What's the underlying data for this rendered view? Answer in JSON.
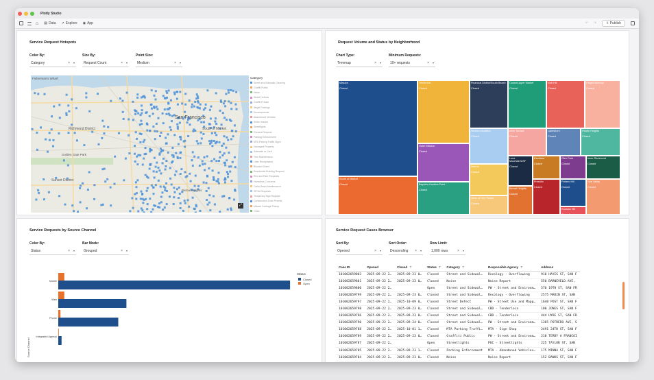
{
  "app": {
    "title": "Plotly Studio",
    "publish_label": "Publish"
  },
  "toolbar": {
    "links": [
      "Data",
      "Explore",
      "App"
    ]
  },
  "panels": {
    "hotspots": {
      "title": "Service Request Hotspots",
      "controls": [
        {
          "label": "Color By:",
          "value": "Category"
        },
        {
          "label": "Size By:",
          "value": "Request Count"
        },
        {
          "label": "Point Size:",
          "value": "Medium"
        }
      ],
      "legend_title": "Category",
      "legend_items": [
        "Street and Sidewalk Cleaning",
        "Graffiti Public",
        "Noise",
        "Street Defects",
        "Graffiti Private",
        "Illegal Postings",
        "Encampments",
        "Abandoned Vehicles",
        "Sewer Issues",
        "Streetlights",
        "General Request",
        "Parking Enforcement",
        "MTA Parking Traffic Signs",
        "Damaged Property",
        "Sidewalk or Curb",
        "Tree Maintenance",
        "Litter Receptacles",
        "Blocked Street",
        "Residential Building Request",
        "Rec and Park Requests",
        "Homeless Concerns",
        "Catch Basin Maintenance",
        "SFHA Requests",
        "Temporary Sign Request",
        "Construction Zone Permits",
        "Missed Garbage Pickup",
        "Other"
      ],
      "map_labels": [
        "Fisherman's Wharf",
        "Richmond District",
        "San Francisco",
        "South of Market",
        "Golden Gate Park",
        "Sunset District",
        "Bernal Heights"
      ],
      "colors": {
        "points": "#4a90d9"
      }
    },
    "volume": {
      "title": "Request Volume and Status by Neighborhood",
      "controls": [
        {
          "label": "Chart Type:",
          "value": "Treemap"
        },
        {
          "label": "Minimum Requests:",
          "value": "10+ requests"
        }
      ],
      "tiles": [
        {
          "label": "Mission",
          "status": "Closed",
          "color": "#1f4e8c"
        },
        {
          "label": "Tenderloin",
          "status": "Closed",
          "color": "#f0b43a"
        },
        {
          "label": "Financial District/South Beach",
          "status": "Closed",
          "color": "#2c3e5a"
        },
        {
          "label": "Castro/Upper Market",
          "status": "Closed",
          "color": "#1f9c78"
        },
        {
          "label": "Nob Hill",
          "status": "Closed",
          "color": "#e8625a"
        },
        {
          "label": "Haight Ashbury",
          "status": "Closed",
          "color": "#f7b19e"
        },
        {
          "label": "South of Market",
          "status": "Closed",
          "color": "#ea6a2f"
        },
        {
          "label": "Outer Mission",
          "status": "Closed",
          "color": "#9b57b8"
        },
        {
          "label": "Western Addition",
          "status": "Closed",
          "color": "#a9cdf0"
        },
        {
          "label": "Inner Sunset",
          "status": "Closed",
          "color": "#f5a6a0"
        },
        {
          "label": "Lakeshore",
          "status": "Closed",
          "color": "#5e84b8"
        },
        {
          "label": "Pacific Heights",
          "status": "Closed",
          "color": "#4fb7a0"
        },
        {
          "label": "Bayview Hunters Point",
          "status": "Closed",
          "color": "#2aa082"
        },
        {
          "label": "Marina",
          "status": "Closed",
          "color": "#f4c95c"
        },
        {
          "label": "Lone Mountain/USF",
          "status": "Closed",
          "color": "#1c2b44"
        },
        {
          "label": "Excelsior",
          "status": "Closed",
          "color": "#c87b22"
        },
        {
          "label": "Glen Park",
          "status": "Closed",
          "color": "#7e3c8e"
        },
        {
          "label": "Inner Richmond",
          "status": "Closed",
          "color": "#1a5c45"
        },
        {
          "label": "Bernal Heights",
          "status": "Closed",
          "color": "#e1722f"
        },
        {
          "label": "Presidio",
          "status": "Closed",
          "color": "#b8262b"
        },
        {
          "label": "Potrero Hill",
          "status": "Closed",
          "color": "#1f4e8c"
        },
        {
          "label": "Noe Valley",
          "status": "Closed",
          "color": "#f39a70"
        },
        {
          "label": "West of Twin Peaks",
          "status": "Closed",
          "color": "#f7c77a"
        },
        {
          "label": "Russian Hill",
          "status": "Closed",
          "color": "#e8525a"
        }
      ]
    },
    "source": {
      "title": "Service Requests by Source Channel",
      "controls": [
        {
          "label": "Color By:",
          "value": "Status"
        },
        {
          "label": "Bar Mode:",
          "value": "Grouped"
        }
      ]
    },
    "browser": {
      "title": "Service Request Cases Browser",
      "controls": [
        {
          "label": "Sort By:",
          "value": "Opened"
        },
        {
          "label": "Sort Order:",
          "value": "Descending"
        },
        {
          "label": "Row Limit:",
          "value": "1,000 rows"
        }
      ],
      "columns": [
        "Case ID",
        "Opened",
        "Closed",
        "Status",
        "Category",
        "Responsible Agency",
        "Address"
      ],
      "rows": [
        [
          "101002659803",
          "2025-09-22 2…",
          "2025-09-23 0…",
          "Closed",
          "Street and Sidewal…",
          "Recology - Overflowing",
          "910 HAYES ST, SAN F"
        ],
        [
          "101002659801",
          "2025-09-22 2…",
          "2025-09-23 0…",
          "Closed",
          "Noise",
          "Noise Report",
          "550 BARNEVELD AVE, "
        ],
        [
          "101002659800",
          "2025-09-22 2…",
          "",
          "Open",
          "Street and Sidewal…",
          "PW - Street and Environm…",
          "570 19TH ST, SAN FR"
        ],
        [
          "101002659799",
          "2025-09-22 2…",
          "2025-09-23 0…",
          "Closed",
          "Street and Sidewal…",
          "Recology - Overflowing",
          "2575 MARIN ST, SAN "
        ],
        [
          "101002659797",
          "2025-09-22 2…",
          "2025-10-09 0…",
          "Closed",
          "Street Defect",
          "PW - Street Use and Mapp…",
          "1640 POST ST, SAN F"
        ],
        [
          "101002659798",
          "2025-09-22 2…",
          "2025-09-23 0…",
          "Closed",
          "Street and Sidewal…",
          "CBD - Tenderloin",
          "100 JONES ST, SAN F"
        ],
        [
          "101002659796",
          "2025-09-22 2…",
          "2025-09-23 0…",
          "Closed",
          "Street and Sidewal…",
          "CBD - Tenderloin",
          "444 HYDE ST, SAN FR"
        ],
        [
          "101002659790",
          "2025-09-22 2…",
          "2025-09-24 0…",
          "Closed",
          "Street and Sidewal…",
          "PW - Street and Environm…",
          "1365 POTRERO AVE, S"
        ],
        [
          "101002659788",
          "2025-09-22 2…",
          "2025-10-01 1…",
          "Closed",
          "MTA Parking Traffi…",
          "MTA - Sign Shop",
          "2491 24TH ST, SAN F"
        ],
        [
          "101002659789",
          "2025-09-22 2…",
          "2025-09-23 0…",
          "Closed",
          "Graffiti Public",
          "PW - Street and Environm…",
          "210 TERRY A FRANCOI"
        ],
        [
          "101002659787",
          "2025-09-22 2…",
          "",
          "Open",
          "Streetlights",
          "PUC - Streetlights",
          "225 TAYLOR ST, SAN "
        ],
        [
          "101002659785",
          "2025-09-22 2…",
          "2025-09-23 1…",
          "Closed",
          "Parking Enforcement",
          "MTA - Abandoned Vehicles…",
          "175 MINNA ST, SAN F"
        ],
        [
          "101002659784",
          "2025-09-22 2…",
          "2025-09-23 0…",
          "Closed",
          "Noise",
          "Noise Report",
          "152 BANKS ST, SAN F"
        ],
        [
          "101002659783",
          "2025-09-22 2…",
          "2025-09-23 1…",
          "Closed",
          "Street and Sidewal…",
          "CBD - Tenderloin",
          "225 TAYLOR ST, SAN "
        ]
      ]
    }
  },
  "chart_data": {
    "type": "bar",
    "orientation": "horizontal",
    "categories": [
      "Mobile",
      "Web",
      "Phone",
      "Integrated Agency"
    ],
    "series": [
      {
        "name": "Closed",
        "values": [
          4250,
          1250,
          1100,
          60
        ]
      },
      {
        "name": "Open",
        "values": [
          110,
          110,
          40,
          10
        ]
      }
    ],
    "legend_title": "Status",
    "ylabel": "Source Channel",
    "colors": {
      "Closed": "#1f4e8c",
      "Open": "#e8702a"
    }
  }
}
